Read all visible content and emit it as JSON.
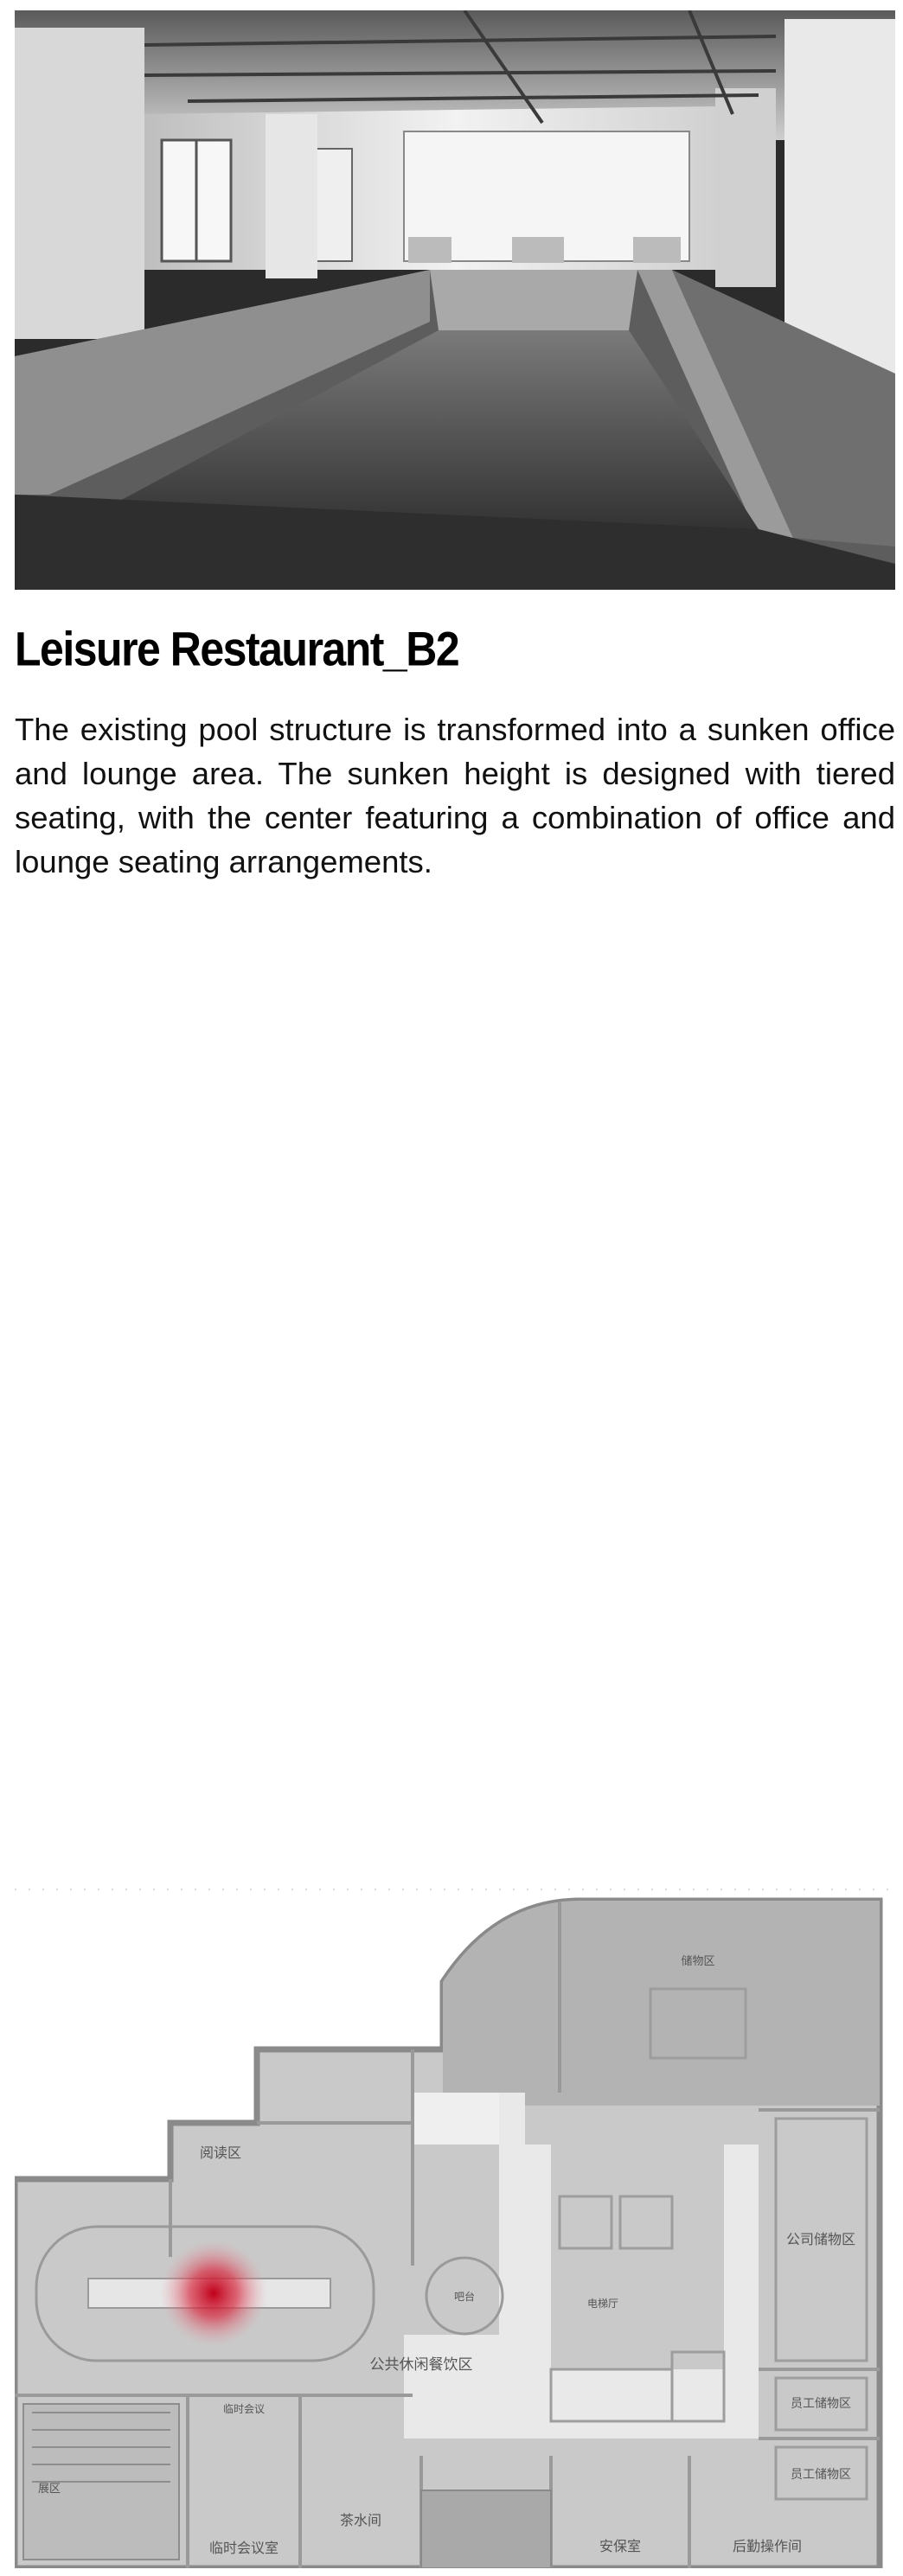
{
  "title": "Leisure Restaurant_B2",
  "description": "The existing pool structure is transformed into a sunken office and lounge area. The sunken height is designed with tiered seating, with the center featuring a combination of office and lounge seating arrangements.",
  "floor_plan": {
    "zone_labels": {
      "reading_area": "阅读区",
      "public_dining": "公共休闲餐饮区",
      "temporary_meeting_room": "临时会议室",
      "temporary_meeting": "临时会议",
      "tea_room": "茶水间",
      "security_room": "安保室",
      "logistics_room": "后勤操作间",
      "company_storage": "公司储物区",
      "staff_storage_1": "员工储物区",
      "staff_storage_2": "员工储物区",
      "bar": "吧台",
      "storage_area": "储物区",
      "elevator_hall": "电梯厅",
      "other": "展区"
    }
  }
}
